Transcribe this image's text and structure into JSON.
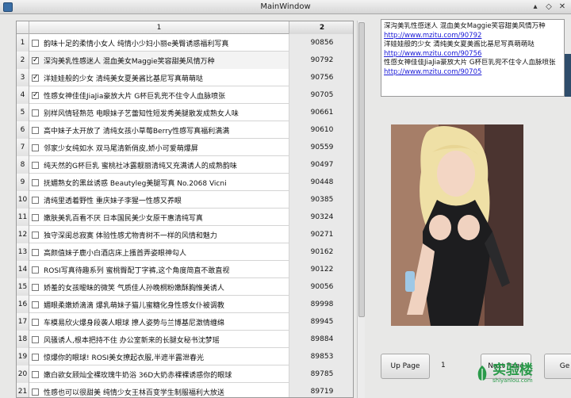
{
  "window": {
    "title": "MainWindow"
  },
  "table": {
    "headers": [
      "1",
      "2"
    ],
    "rows": [
      {
        "n": "1",
        "checked": false,
        "text": "韵味十足的柔情小女人 纯情小少妇小丽e美臀诱惑福利写真",
        "id": "90856"
      },
      {
        "n": "2",
        "checked": true,
        "text": "深沟美乳性感迷人 混血美女Maggie笑容甜美风情万种",
        "id": "90792"
      },
      {
        "n": "3",
        "checked": true,
        "text": "洋娃娃般的少女 清纯美女夏美酱比基尼写真萌萌哒",
        "id": "90756"
      },
      {
        "n": "4",
        "checked": true,
        "text": "性感女神佳佳JiaJia豪放大片 G杯巨乳兜不住令人血脉喷张",
        "id": "90705"
      },
      {
        "n": "5",
        "checked": false,
        "text": "别样风情轻熟范 电眼妹子艺蕾知性短发秀美腿散发成熟女人味",
        "id": "90661"
      },
      {
        "n": "6",
        "checked": false,
        "text": "高中妹子太开放了 清纯女孩小草莓Berry性感写真福利满满",
        "id": "90610"
      },
      {
        "n": "7",
        "checked": false,
        "text": "邻家少女纯如水 双马尾清新俏皮,娇小可爱萌爆屏",
        "id": "90559"
      },
      {
        "n": "8",
        "checked": false,
        "text": "纯天然的G杯巨乳 蜜桃社冰露靓丽清纯又充满诱人的成熟韵味",
        "id": "90497"
      },
      {
        "n": "9",
        "checked": false,
        "text": "抚媚熟女的黑丝诱惑 Beautyleg美腿写真 No.2068 Vicni",
        "id": "90448"
      },
      {
        "n": "10",
        "checked": false,
        "text": "清纯里透着野性 重庆妹子李猩一性感又养眼",
        "id": "90385"
      },
      {
        "n": "11",
        "checked": false,
        "text": "嫩肤美乳百看不厌 日本国民美少女原干惠清纯写真",
        "id": "90324"
      },
      {
        "n": "12",
        "checked": false,
        "text": "独守深闺总寂寞 体验性感尤物青树不一样的风情和魅力",
        "id": "90271"
      },
      {
        "n": "13",
        "checked": false,
        "text": "高颜值妹子鹿小白酒店床上搔首弄姿眼神勾人",
        "id": "90162"
      },
      {
        "n": "14",
        "checked": false,
        "text": "ROSI写真待趣系列 蜜桃臀配丁字裤,这个角度简直不敢直视",
        "id": "90122"
      },
      {
        "n": "15",
        "checked": false,
        "text": "娇羞的女孩暧昧的微笑 气质佳人孙晚桐粉嫩酥胸惟美诱人",
        "id": "90056"
      },
      {
        "n": "16",
        "checked": false,
        "text": "媚眼柔嫩娇滴滴 爆乳萌妹子猫儿蜜糖化身性感女仆被调教",
        "id": "89998"
      },
      {
        "n": "17",
        "checked": false,
        "text": "车模易欣火爆身段袭人眼球 撩人姿势与兰博基尼激情缠绵",
        "id": "89945"
      },
      {
        "n": "18",
        "checked": false,
        "text": "风骚诱人,根本把持不住 办公室新来的长腿女秘书沈梦瑶",
        "id": "89884"
      },
      {
        "n": "19",
        "checked": false,
        "text": "惊爆你的眼球! ROSI美女撩起衣服,半遮半露泄春光",
        "id": "89853"
      },
      {
        "n": "20",
        "checked": false,
        "text": "嫩白欲女顾灿全裸玫瑰牛奶浴 36D大奶赤裸裸诱惑你的眼球",
        "id": "89785"
      },
      {
        "n": "21",
        "checked": false,
        "text": "性感也可以很甜美 纯情少女王林百变学生制服福利大放送",
        "id": "89719"
      }
    ]
  },
  "details": {
    "lines": [
      {
        "text": "深沟美乳性感迷人 混血美女Maggie笑容甜美风情万种",
        "link": "http://www.mzitu.com/90792"
      },
      {
        "text": "洋娃娃般的少女 清纯美女夏美酱比基尼写真萌萌哒",
        "link": "http://www.mzitu.com/90756"
      },
      {
        "text": "性感女神佳佳JiaJia豪放大片 G杯巨乳兜不住令人血脉喷张",
        "link": "http://www.mzitu.com/90705"
      }
    ]
  },
  "pager": {
    "up_label": "Up Page",
    "page": "1",
    "next_label": "Next Page",
    "go_label": "Ge"
  },
  "watermark": {
    "big": "实验楼",
    "small": "shiyanlou.com"
  },
  "colors": {
    "link": "#1a1ad6",
    "accent_green": "#2a9a4a"
  }
}
